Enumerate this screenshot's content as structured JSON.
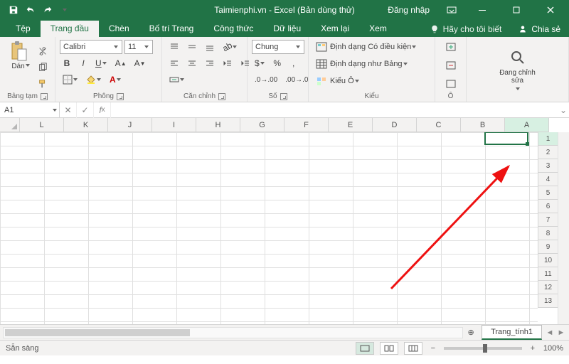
{
  "title": "Taimienphi.vn - Excel (Bản dùng thử)",
  "signin": "Đăng nhập",
  "tabs": {
    "file": "Tệp",
    "home": "Trang đầu",
    "insert": "Chèn",
    "layout": "Bố trí Trang",
    "formulas": "Công thức",
    "data": "Dữ liệu",
    "review": "Xem lại",
    "view": "Xem"
  },
  "tellme": "Hãy cho tôi biết",
  "share": "Chia sẻ",
  "ribbon": {
    "clipboard": {
      "paste": "Dán",
      "label": "Bảng tạm"
    },
    "font": {
      "name": "Calibri",
      "size": "11",
      "label": "Phông"
    },
    "alignment": {
      "wrap": "Chung",
      "label": "Căn chỉnh"
    },
    "number": {
      "label": "Số"
    },
    "styles": {
      "cond": "Định dạng Có điều kiện",
      "table": "Định dạng như Bảng",
      "cell": "Kiểu Ô",
      "label": "Kiểu"
    },
    "cells": {
      "label": "Ô"
    },
    "editing": {
      "label": "Đang chỉnh sửa"
    }
  },
  "namebox": "A1",
  "columns": [
    "L",
    "K",
    "J",
    "I",
    "H",
    "G",
    "F",
    "E",
    "D",
    "C",
    "B",
    "A"
  ],
  "rows": [
    "1",
    "2",
    "3",
    "4",
    "5",
    "6",
    "7",
    "8",
    "9",
    "10",
    "11",
    "12",
    "13"
  ],
  "sheet": {
    "name": "Trang_tính1",
    "new": "⊕"
  },
  "status": {
    "ready": "Sẵn sàng",
    "zoom": "100%"
  }
}
